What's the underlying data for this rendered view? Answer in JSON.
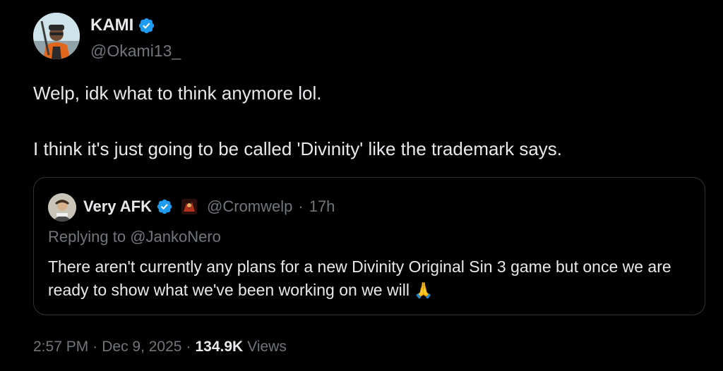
{
  "author": {
    "display_name": "KAMI",
    "handle": "@Okami13_",
    "verified": true
  },
  "tweet": {
    "line1": "Welp, idk what to think anymore lol.",
    "line2": "I think it's just going to be called 'Divinity' like the trademark says."
  },
  "quoted": {
    "display_name": "Very AFK",
    "handle": "@Cromwelp",
    "separator": "·",
    "time": "17h",
    "replying_prefix": "Replying to ",
    "replying_to": "@JankoNero",
    "text": "There aren't currently any plans for a new Divinity Original Sin 3 game but once we are ready to show what we've been working on we will",
    "emoji": "🙏"
  },
  "meta": {
    "time": "2:57 PM",
    "separator1": "·",
    "date": "Dec 9, 2025",
    "separator2": "·",
    "views_count": "134.9K",
    "views_label": "Views"
  },
  "colors": {
    "background": "#000000",
    "text": "#e7e9ea",
    "secondary": "#71767b",
    "verified": "#1d9bf0",
    "border": "#2f3336"
  },
  "icons": [
    "avatar",
    "verified-badge-icon",
    "affiliate-badge-icon",
    "praying-hands-emoji"
  ]
}
